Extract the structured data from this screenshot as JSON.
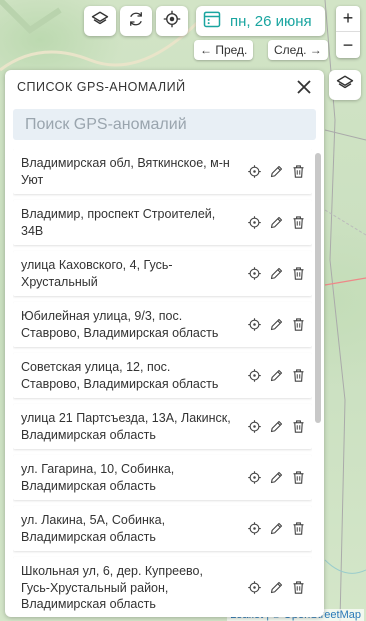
{
  "map": {
    "attribution": "Leaflet | © OpenStreetMap"
  },
  "toolbar": {
    "layers_icon": "layers-icon",
    "refresh_icon": "refresh-icon",
    "locate_icon": "locate-icon",
    "calendar_icon": "calendar-icon",
    "date_label": "пн, 26 июня",
    "prev_label": "← Пред.",
    "next_label": "След. →"
  },
  "zoom": {
    "in": "+",
    "out": "−"
  },
  "panel": {
    "title": "СПИСОК GPS-АНОМАЛИЙ",
    "search_placeholder": "Поиск GPS-аномалий",
    "search_value": "",
    "items": [
      {
        "address": "Владимирская обл, Вяткинское, м-н Уют"
      },
      {
        "address": "Владимир, проспект Строителей, 34В"
      },
      {
        "address": "улица Каховского, 4, Гусь-Хрустальный"
      },
      {
        "address": "Юбилейная улица, 9/3, пос. Ставрово, Владимирская область"
      },
      {
        "address": "Советская улица, 12, пос. Ставрово, Владимирская область"
      },
      {
        "address": "улица 21 Партсъезда, 13А, Лакинск, Владимирская область"
      },
      {
        "address": "ул. Гагарина, 10, Собинка, Владимирская область"
      },
      {
        "address": "ул. Лакина, 5А, Собинка, Владимирская область"
      },
      {
        "address": "Школьная ул, 6, дер. Купреево, Гусь-Хрустальный район, Владимирская область"
      }
    ]
  },
  "colors": {
    "accent": "#1aa5a0",
    "search_bg": "#e8eff5"
  }
}
